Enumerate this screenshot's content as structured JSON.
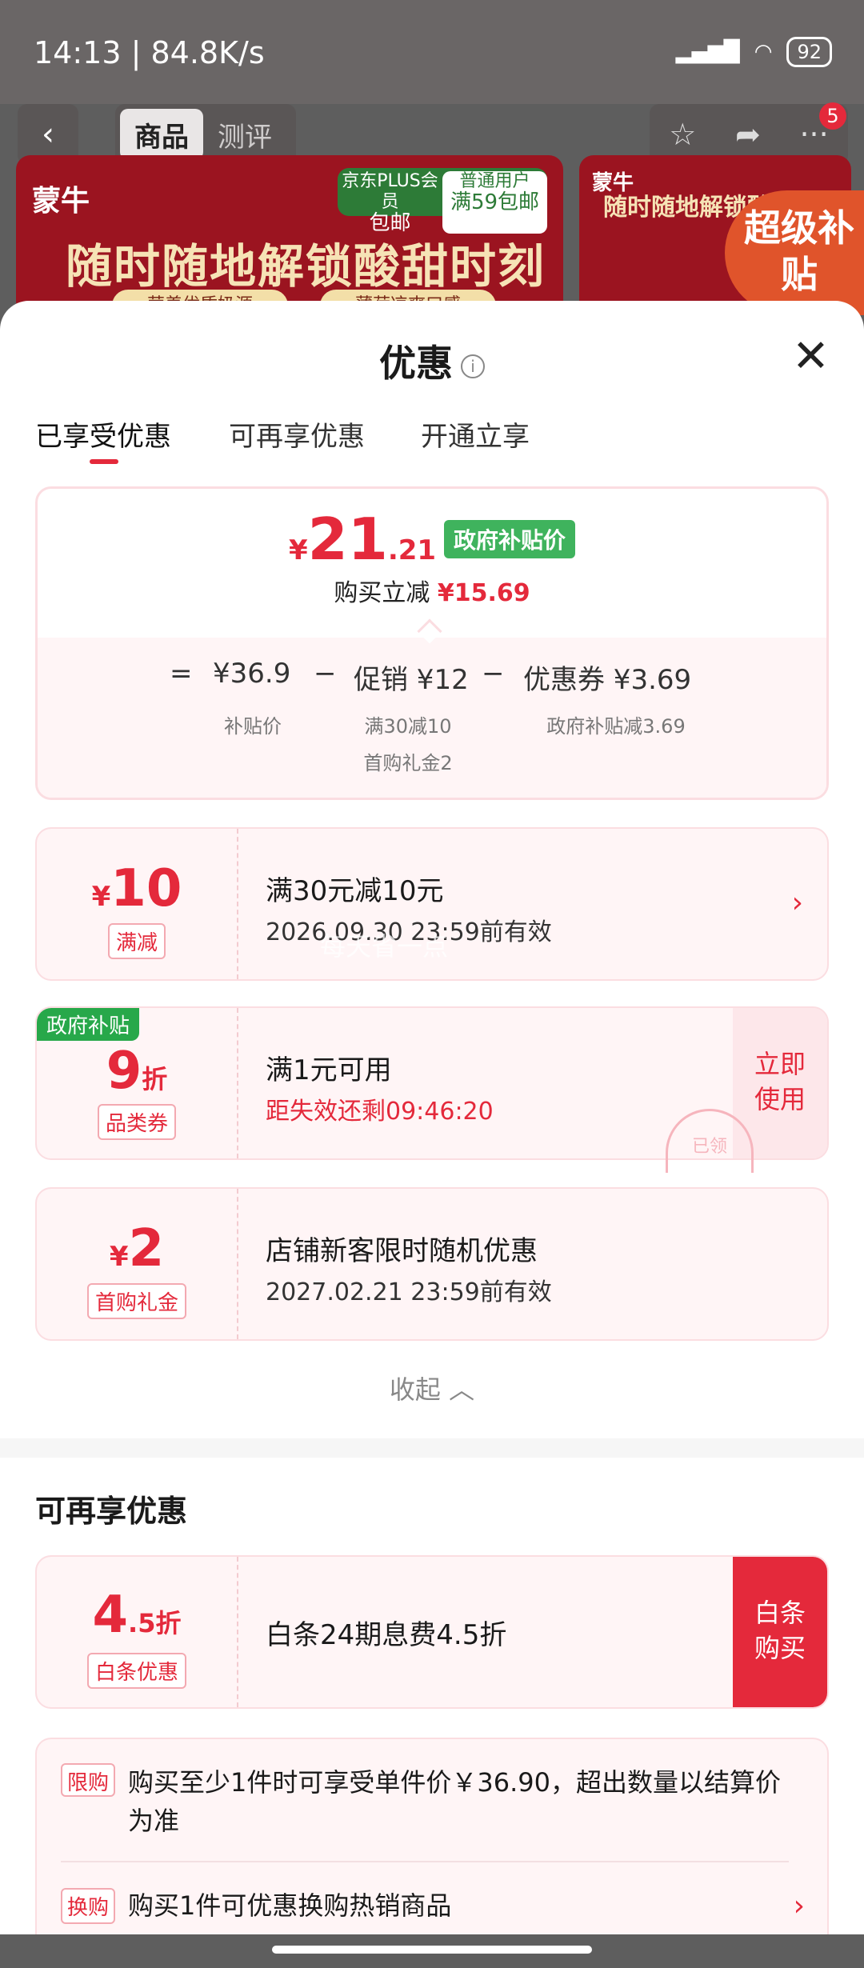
{
  "status": {
    "time": "14:13",
    "speed": "84.8K/s",
    "battery": "92"
  },
  "nav": {
    "back_icon": "chevron-left-icon",
    "tab_product": "商品",
    "tab_review": "测评",
    "cart_badge": "5"
  },
  "banner": {
    "brand": "蒙牛",
    "plus_line1": "京东PLUS会员",
    "plus_line2": "包邮",
    "user_line1": "普通用户",
    "user_line2": "满59包邮",
    "slogan": "随时随地解锁酸甜时刻",
    "pill1": "营养优质奶源",
    "pill2": "薄荷凉爽口感",
    "slogan2": "随时随地解锁酸甜",
    "super_label": "超级补贴"
  },
  "sheet": {
    "title": "优惠",
    "info_icon": "i",
    "close_icon": "close-icon"
  },
  "tabs": [
    "已享受优惠",
    "可再享优惠",
    "开通立享"
  ],
  "summary": {
    "yen": "¥",
    "price_int": "21",
    "price_dec": ".21",
    "price_tag": "政府补贴价",
    "reduce_label": "购买立减",
    "reduce_value": "¥15.69",
    "eq": "=",
    "minus": "−",
    "base_value": "¥36.9",
    "base_label": "补贴价",
    "promo_value": "促销 ¥12",
    "promo_label1": "满30减10",
    "promo_label2": "首购礼金2",
    "coupon_value": "优惠券 ¥3.69",
    "coupon_label": "政府补贴减3.69"
  },
  "coupons": [
    {
      "amount_prefix": "¥",
      "amount": "10",
      "tag": "满减",
      "line1": "满30元减10元",
      "line2": "2026.09.30 23:59前有效"
    },
    {
      "gov_label": "政府补贴",
      "amount": "9",
      "amount_suffix": "折",
      "tag": "品类券",
      "line1": "满1元可用",
      "line2": "距失效还剩09:46:20",
      "action": "立即使用",
      "stamp": "已领"
    },
    {
      "amount_prefix": "¥",
      "amount": "2",
      "tag": "首购礼金",
      "line1": "店铺新客限时随机优惠",
      "line2": "2027.02.21 23:59前有效"
    }
  ],
  "watermark": "每天省一点",
  "collapse_label": "收起",
  "more": {
    "title": "可再享优惠",
    "amount": "4",
    "amount_dec": ".5折",
    "tag": "白条优惠",
    "line1": "白条24期息费4.5折",
    "action": "白条购买"
  },
  "rules": [
    {
      "tag": "限购",
      "text": "购买至少1件时可享受单件价￥36.90，超出数量以结算价为准"
    },
    {
      "tag": "换购",
      "text": "购买1件可优惠换购热销商品"
    }
  ],
  "colors": {
    "accent": "#e4293b",
    "gov_green": "#3fb35d",
    "card_bg": "#fff5f6"
  }
}
